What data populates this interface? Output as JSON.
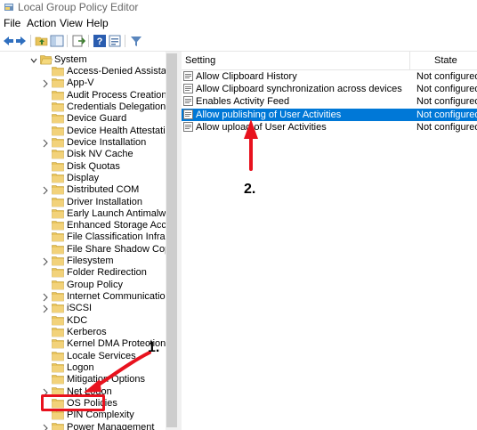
{
  "window": {
    "title": "Local Group Policy Editor"
  },
  "menu": [
    "File",
    "Action",
    "View",
    "Help"
  ],
  "toolbar": {
    "icons": [
      "back-arrow-icon",
      "forward-arrow-icon",
      "up-folder-icon",
      "show-hide-tree-icon",
      "export-list-icon",
      "help-icon",
      "properties-icon",
      "filter-icon"
    ]
  },
  "tree": {
    "parent": "System",
    "items": [
      {
        "label": "Access-Denied Assistance",
        "expandable": false
      },
      {
        "label": "App-V",
        "expandable": true
      },
      {
        "label": "Audit Process Creation",
        "expandable": false
      },
      {
        "label": "Credentials Delegation",
        "expandable": false
      },
      {
        "label": "Device Guard",
        "expandable": false
      },
      {
        "label": "Device Health Attestation Se",
        "expandable": false
      },
      {
        "label": "Device Installation",
        "expandable": true
      },
      {
        "label": "Disk NV Cache",
        "expandable": false
      },
      {
        "label": "Disk Quotas",
        "expandable": false
      },
      {
        "label": "Display",
        "expandable": false
      },
      {
        "label": "Distributed COM",
        "expandable": true
      },
      {
        "label": "Driver Installation",
        "expandable": false
      },
      {
        "label": "Early Launch Antimalware",
        "expandable": false
      },
      {
        "label": "Enhanced Storage Access",
        "expandable": false
      },
      {
        "label": "File Classification Infrastruct",
        "expandable": false
      },
      {
        "label": "File Share Shadow Copy Prov",
        "expandable": false
      },
      {
        "label": "Filesystem",
        "expandable": true
      },
      {
        "label": "Folder Redirection",
        "expandable": false
      },
      {
        "label": "Group Policy",
        "expandable": false
      },
      {
        "label": "Internet Communication Ma",
        "expandable": true
      },
      {
        "label": "iSCSI",
        "expandable": true
      },
      {
        "label": "KDC",
        "expandable": false
      },
      {
        "label": "Kerberos",
        "expandable": false
      },
      {
        "label": "Kernel DMA Protection",
        "expandable": false
      },
      {
        "label": "Locale Services",
        "expandable": false
      },
      {
        "label": "Logon",
        "expandable": false
      },
      {
        "label": "Mitigation Options",
        "expandable": false
      },
      {
        "label": "Net Logon",
        "expandable": true
      },
      {
        "label": "OS Policies",
        "expandable": false
      },
      {
        "label": "PIN Complexity",
        "expandable": false
      },
      {
        "label": "Power Management",
        "expandable": true
      }
    ]
  },
  "list": {
    "columns": [
      "Setting",
      "State"
    ],
    "rows": [
      {
        "name": "Allow Clipboard History",
        "state": "Not configured",
        "selected": false
      },
      {
        "name": "Allow Clipboard synchronization across devices",
        "state": "Not configured",
        "selected": false
      },
      {
        "name": "Enables Activity Feed",
        "state": "Not configured",
        "selected": false
      },
      {
        "name": "Allow publishing of User Activities",
        "state": "Not configured",
        "selected": true
      },
      {
        "name": "Allow upload of User Activities",
        "state": "Not configured",
        "selected": false
      }
    ]
  },
  "annotations": {
    "step1": "1.",
    "step2": "2.",
    "color": "#e8121e"
  },
  "colors": {
    "selection": "#0078d7",
    "folder": "#e8c35a"
  }
}
